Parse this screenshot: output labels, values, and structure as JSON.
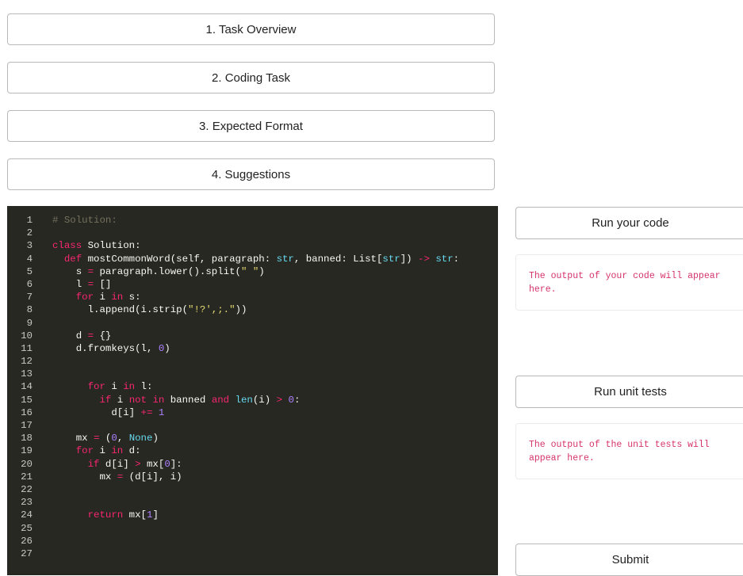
{
  "sections": [
    {
      "label": "1. Task Overview"
    },
    {
      "label": "2. Coding Task"
    },
    {
      "label": "3. Expected Format"
    },
    {
      "label": "4. Suggestions"
    }
  ],
  "editor": {
    "line_numbers": [
      "1",
      "2",
      "3",
      "4",
      "5",
      "6",
      "7",
      "8",
      "9",
      "10",
      "11",
      "12",
      "13",
      "14",
      "15",
      "16",
      "17",
      "18",
      "19",
      "20",
      "21",
      "22",
      "23",
      "24",
      "25",
      "26",
      "27"
    ],
    "lines": [
      "# Solution:",
      "",
      "class Solution:",
      "  def mostCommonWord(self, paragraph: str, banned: List[str]) -> str:",
      "    s = paragraph.lower().split(\" \")",
      "    l = []",
      "    for i in s:",
      "      l.append(i.strip(\"!?',;.\"))",
      "",
      "    d = {}",
      "    d.fromkeys(l, 0)",
      "",
      "",
      "      for i in l:",
      "        if i not in banned and len(i) > 0:",
      "          d[i] += 1",
      "",
      "    mx = (0, None)",
      "    for i in d:",
      "      if d[i] > mx[0]:",
      "        mx = (d[i], i)",
      "",
      "",
      "      return mx[1]",
      "",
      "",
      ""
    ]
  },
  "run_code": {
    "label": "Run your code",
    "output": "The output of your code will appear here."
  },
  "run_tests": {
    "label": "Run unit tests",
    "output": "The output of the unit tests will appear here."
  },
  "submit": {
    "label": "Submit"
  },
  "colors": {
    "editor_bg": "#272822",
    "keyword": "#f92672",
    "comment": "#75715e",
    "string": "#e6db74",
    "number": "#ae81ff",
    "output_text": "#d6336c"
  }
}
